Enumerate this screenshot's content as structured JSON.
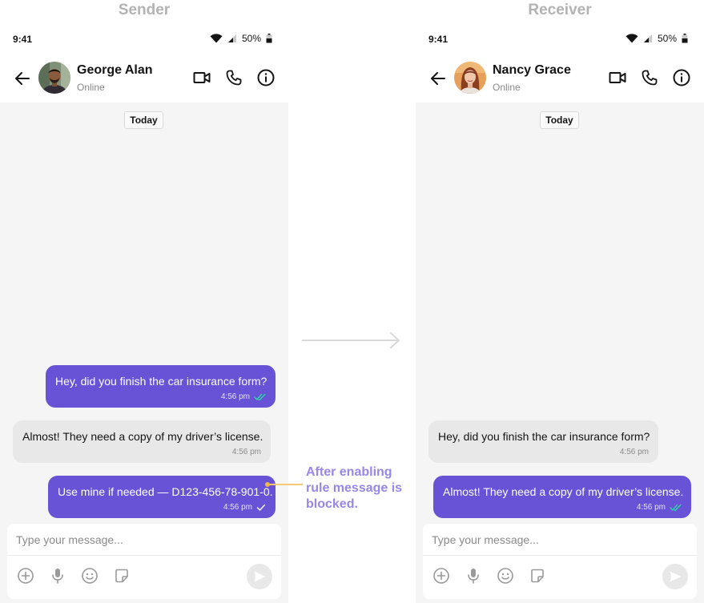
{
  "sender_panel": {
    "title": "Sender",
    "status_bar": {
      "time": "9:41",
      "battery": "50%"
    },
    "header": {
      "name": "George Alan",
      "status": "Online"
    },
    "date_chip": "Today",
    "messages": [
      {
        "direction": "outgoing",
        "text": "Hey, did you finish the car insurance form?",
        "time": "4:56 pm",
        "receipt": "read"
      },
      {
        "direction": "incoming",
        "text": "Almost! They need a copy of my driver’s license.",
        "time": "4:56 pm"
      },
      {
        "direction": "outgoing",
        "text": "Use mine if needed — D123-456-78-901-0.",
        "time": "4:56 pm",
        "receipt": "sent"
      }
    ],
    "composer": {
      "placeholder": "Type your message..."
    }
  },
  "receiver_panel": {
    "title": "Receiver",
    "status_bar": {
      "time": "9:41",
      "battery": "50%"
    },
    "header": {
      "name": "Nancy Grace",
      "status": "Online"
    },
    "date_chip": "Today",
    "messages": [
      {
        "direction": "incoming",
        "text": "Hey, did you finish the car insurance form?",
        "time": "4:56 pm"
      },
      {
        "direction": "outgoing",
        "text": "Almost! They need a copy of my driver’s license.",
        "time": "4:56 pm",
        "receipt": "read"
      }
    ],
    "composer": {
      "placeholder": "Type your message..."
    }
  },
  "annotation": {
    "text": "After enabling rule message is blocked."
  },
  "icons": {
    "header": [
      "back-arrow-icon",
      "video-call-icon",
      "voice-call-icon",
      "info-icon"
    ],
    "composer": [
      "add-attachment-icon",
      "microphone-icon",
      "emoji-icon",
      "sticker-icon",
      "send-icon"
    ],
    "status": [
      "wifi-icon",
      "cellular-signal-icon",
      "battery-icon"
    ],
    "receipts": [
      "double-check-read-icon",
      "single-check-sent-icon"
    ]
  },
  "colors": {
    "accent": "#6852d6",
    "incoming_bubble": "#e8e8e8",
    "chat_background": "#f5f5f5",
    "read_receipt": "#2fd5a7",
    "annotation_text": "#9887e8",
    "annotation_pointer": "#f5b642"
  }
}
